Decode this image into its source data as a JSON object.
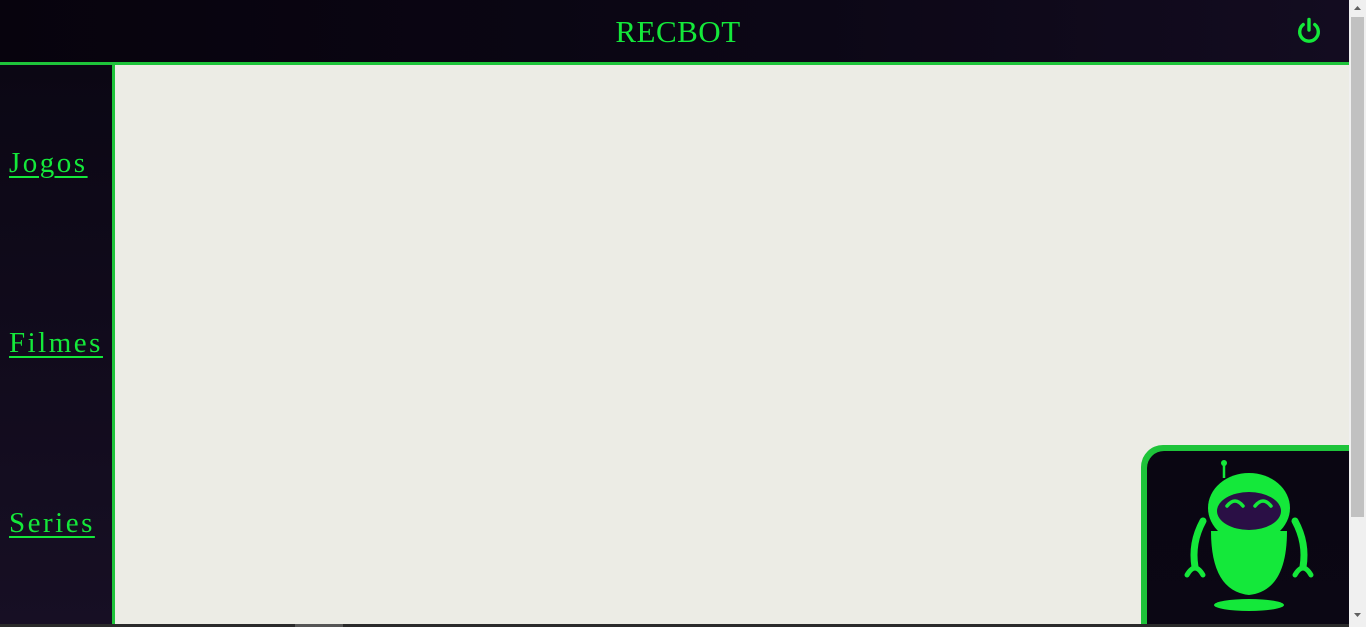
{
  "header": {
    "title": "RECBOT",
    "power_icon": "power-icon"
  },
  "sidebar": {
    "items": [
      {
        "label": "Jogos"
      },
      {
        "label": "Filmes"
      },
      {
        "label": "Series"
      }
    ]
  },
  "chatbot": {
    "icon": "robot-icon"
  },
  "colors": {
    "accent": "#14e83a",
    "border": "#1ec43a",
    "background_dark": "#0b0714",
    "content_bg": "#ecece5",
    "robot_visor": "#2a0f45"
  }
}
